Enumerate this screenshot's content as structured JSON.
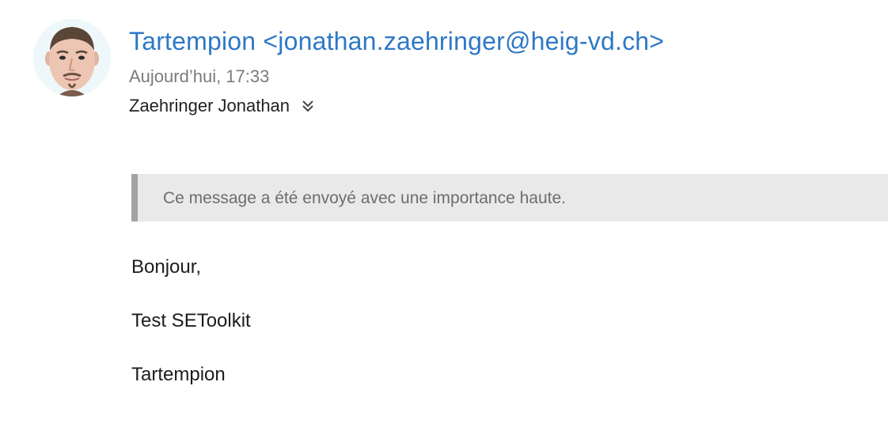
{
  "message": {
    "sender": "Tartempion <jonathan.zaehringer@heig-vd.ch>",
    "date": "Aujourd’hui, 17:33",
    "recipient": "Zaehringer Jonathan",
    "importance_notice": "Ce message a été envoyé avec une importance haute.",
    "body": {
      "greeting": "Bonjour,",
      "content": "Test SEToolkit",
      "signature": "Tartempion"
    }
  },
  "icons": {
    "avatar": "avatar-photo",
    "expand": "double-chevron-down-icon"
  },
  "colors": {
    "sender": "#2e78c6",
    "importance_bg": "#e9e9e9",
    "importance_bar": "#a3a3a3"
  }
}
